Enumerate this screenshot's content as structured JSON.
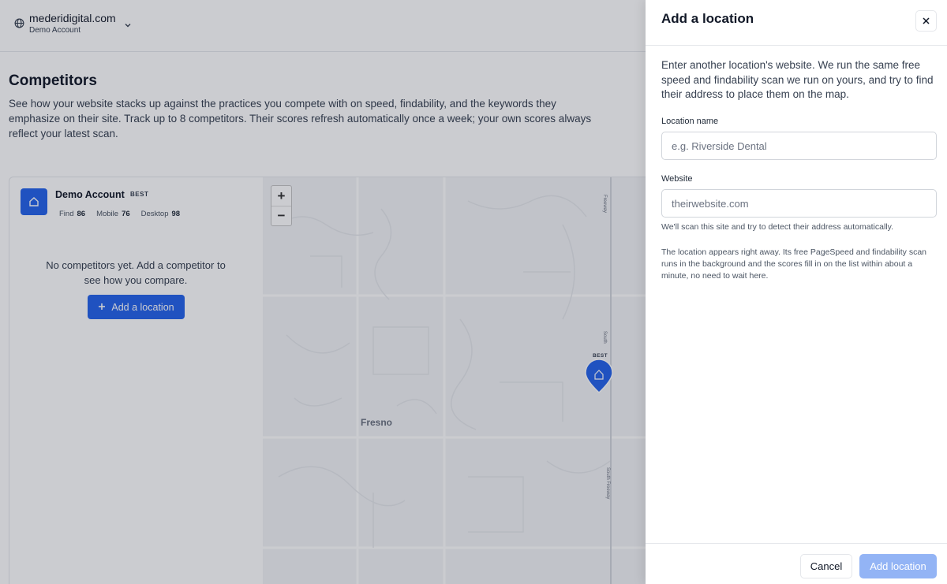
{
  "header": {
    "account_name": "mederidigital.com",
    "account_sub": "Demo Account"
  },
  "page": {
    "title": "Competitors",
    "description": "See how your website stacks up against the practices you compete with on speed, findability, and the keywords they emphasize on their site. Track up to 8 competitors. Their scores refresh automatically once a week; your own scores always reflect your latest scan."
  },
  "card": {
    "name": "Demo Account",
    "badge": "BEST",
    "scores": [
      {
        "label": "Find",
        "value": "86"
      },
      {
        "label": "Mobile",
        "value": "76"
      },
      {
        "label": "Desktop",
        "value": "98"
      }
    ],
    "empty_message": "No competitors yet. Add a competitor to see how you compare.",
    "add_button": "Add a location"
  },
  "map": {
    "zoom_in": "+",
    "zoom_out": "−",
    "city_label": "Fresno",
    "pin_label": "BEST",
    "road_label_1": "Freeway",
    "road_label_2": "South",
    "road_label_3": "South Freeway"
  },
  "drawer": {
    "title": "Add a location",
    "intro": "Enter another location's website. We run the same free speed and findability scan we run on yours, and try to find their address to place them on the map.",
    "location_label": "Location name",
    "location_placeholder": "e.g. Riverside Dental",
    "website_label": "Website",
    "website_placeholder": "theirwebsite.com",
    "hint": "We'll scan this site and try to detect their address automatically.",
    "note": "The location appears right away. Its free PageSpeed and findability scan runs in the background and the scores fill in on the list within about a minute, no need to wait here.",
    "cancel": "Cancel",
    "submit": "Add location"
  },
  "colors": {
    "accent": "#2563eb",
    "accent_disabled": "#93b4f5"
  }
}
